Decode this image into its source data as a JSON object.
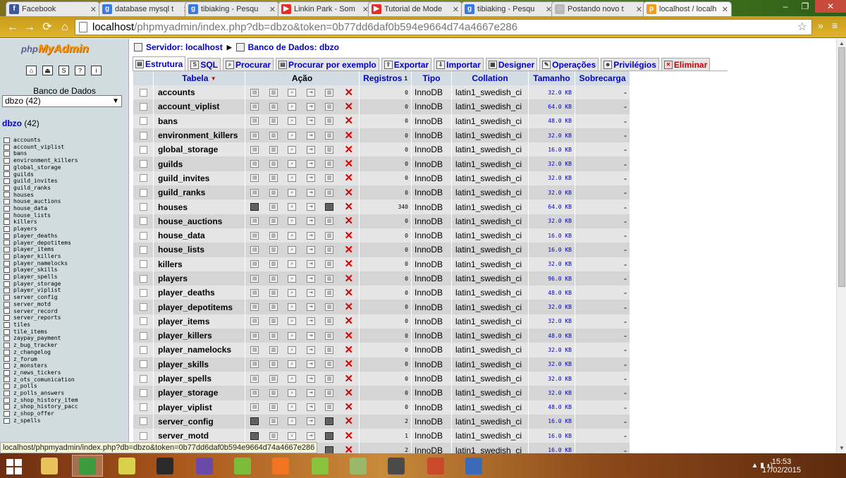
{
  "browser": {
    "tabs": [
      {
        "title": "Facebook",
        "icon": "facebook-icon",
        "color": "#3b5998",
        "glyph": "f"
      },
      {
        "title": "database mysql t",
        "icon": "google-icon",
        "color": "#3b78e7",
        "glyph": "g"
      },
      {
        "title": "tibiaking - Pesqu",
        "icon": "google-icon",
        "color": "#3b78e7",
        "glyph": "g"
      },
      {
        "title": "Linkin Park - Som",
        "icon": "youtube-icon",
        "color": "#e52d27",
        "glyph": "▶"
      },
      {
        "title": "Tutorial de Mode",
        "icon": "youtube-icon",
        "color": "#e52d27",
        "glyph": "▶"
      },
      {
        "title": "tibiaking - Pesqu",
        "icon": "google-icon",
        "color": "#3b78e7",
        "glyph": "g"
      },
      {
        "title": "Postando novo t",
        "icon": "loading-icon",
        "color": "#b9b9b9",
        "glyph": "◌"
      },
      {
        "title": "localhost / localh",
        "icon": "phpmyadmin-icon",
        "color": "#f59c1a",
        "glyph": "p"
      }
    ],
    "url_host": "localhost",
    "url_path": "/phpmyadmin/index.php?db=dbzo&token=0b77dd6daf0b594e9664d74a4667e286"
  },
  "sidebar": {
    "logo_php": "php",
    "logo_rest": "MyAdmin",
    "icons": [
      "home-icon",
      "exit-icon",
      "sql-icon",
      "docs-icon",
      "help-icon"
    ],
    "db_label": "Banco de Dados",
    "db_selected": "dbzo (42)",
    "db_name": "dbzo",
    "db_count": "(42)",
    "tables": [
      "accounts",
      "account_viplist",
      "bans",
      "environment_killers",
      "global_storage",
      "guilds",
      "guild_invites",
      "guild_ranks",
      "houses",
      "house_auctions",
      "house_data",
      "house_lists",
      "killers",
      "players",
      "player_deaths",
      "player_depotitems",
      "player_items",
      "player_killers",
      "player_namelocks",
      "player_skills",
      "player_spells",
      "player_storage",
      "player_viplist",
      "server_config",
      "server_motd",
      "server_record",
      "server_reports",
      "tiles",
      "tile_items",
      "zaypay_payment",
      "z_bug_tracker",
      "z_changelog",
      "z_forum",
      "z_monsters",
      "z_news_tickers",
      "z_ots_comunication",
      "z_polls",
      "z_polls_answers",
      "z_shop_history_item",
      "z_shop_history_pacc",
      "z_shop_offer",
      "z_spells"
    ]
  },
  "main": {
    "crumb_server_label": "Servidor: localhost",
    "crumb_db_label": "Banco de Dados: dbzo",
    "tabs": [
      {
        "label": "Estrutura",
        "icon": "structure-icon",
        "glyph": "▤",
        "active": true
      },
      {
        "label": "SQL",
        "icon": "sql-icon",
        "glyph": "S"
      },
      {
        "label": "Procurar",
        "icon": "search-icon",
        "glyph": "⌕"
      },
      {
        "label": "Procurar por exemplo",
        "icon": "query-icon",
        "glyph": "▤"
      },
      {
        "label": "Exportar",
        "icon": "export-icon",
        "glyph": "⇪"
      },
      {
        "label": "Importar",
        "icon": "import-icon",
        "glyph": "⇩"
      },
      {
        "label": "Designer",
        "icon": "designer-icon",
        "glyph": "▦"
      },
      {
        "label": "Operações",
        "icon": "wrench-icon",
        "glyph": "✎"
      },
      {
        "label": "Privilégios",
        "icon": "privileges-icon",
        "glyph": "☻"
      },
      {
        "label": "Eliminar",
        "icon": "drop-icon",
        "glyph": "✕",
        "danger": true
      }
    ],
    "columns": {
      "tabela": "Tabela",
      "sort_arrow": "▼",
      "acao": "Ação",
      "registros": "Registros",
      "registros_sup": "1",
      "tipo": "Tipo",
      "collation": "Collation",
      "tamanho": "Tamanho",
      "sobrecarga": "Sobrecarga"
    },
    "rows": [
      {
        "name": "accounts",
        "records": "0",
        "type": "InnoDB",
        "collation": "latin1_swedish_ci",
        "size": "32.0 KB",
        "overhead": "-"
      },
      {
        "name": "account_viplist",
        "records": "0",
        "type": "InnoDB",
        "collation": "latin1_swedish_ci",
        "size": "64.0 KB",
        "overhead": "-"
      },
      {
        "name": "bans",
        "records": "0",
        "type": "InnoDB",
        "collation": "latin1_swedish_ci",
        "size": "48.0 KB",
        "overhead": "-"
      },
      {
        "name": "environment_killers",
        "records": "0",
        "type": "InnoDB",
        "collation": "latin1_swedish_ci",
        "size": "32.0 KB",
        "overhead": "-"
      },
      {
        "name": "global_storage",
        "records": "0",
        "type": "InnoDB",
        "collation": "latin1_swedish_ci",
        "size": "16.0 KB",
        "overhead": "-"
      },
      {
        "name": "guilds",
        "records": "0",
        "type": "InnoDB",
        "collation": "latin1_swedish_ci",
        "size": "32.0 KB",
        "overhead": "-"
      },
      {
        "name": "guild_invites",
        "records": "0",
        "type": "InnoDB",
        "collation": "latin1_swedish_ci",
        "size": "32.0 KB",
        "overhead": "-"
      },
      {
        "name": "guild_ranks",
        "records": "0",
        "type": "InnoDB",
        "collation": "latin1_swedish_ci",
        "size": "32.0 KB",
        "overhead": "-"
      },
      {
        "name": "houses",
        "records": "340",
        "type": "InnoDB",
        "collation": "latin1_swedish_ci",
        "size": "64.0 KB",
        "overhead": "-",
        "filled": true
      },
      {
        "name": "house_auctions",
        "records": "0",
        "type": "InnoDB",
        "collation": "latin1_swedish_ci",
        "size": "32.0 KB",
        "overhead": "-"
      },
      {
        "name": "house_data",
        "records": "0",
        "type": "InnoDB",
        "collation": "latin1_swedish_ci",
        "size": "16.0 KB",
        "overhead": "-"
      },
      {
        "name": "house_lists",
        "records": "0",
        "type": "InnoDB",
        "collation": "latin1_swedish_ci",
        "size": "16.0 KB",
        "overhead": "-"
      },
      {
        "name": "killers",
        "records": "0",
        "type": "InnoDB",
        "collation": "latin1_swedish_ci",
        "size": "32.0 KB",
        "overhead": "-"
      },
      {
        "name": "players",
        "records": "0",
        "type": "InnoDB",
        "collation": "latin1_swedish_ci",
        "size": "96.0 KB",
        "overhead": "-"
      },
      {
        "name": "player_deaths",
        "records": "0",
        "type": "InnoDB",
        "collation": "latin1_swedish_ci",
        "size": "48.0 KB",
        "overhead": "-"
      },
      {
        "name": "player_depotitems",
        "records": "0",
        "type": "InnoDB",
        "collation": "latin1_swedish_ci",
        "size": "32.0 KB",
        "overhead": "-"
      },
      {
        "name": "player_items",
        "records": "0",
        "type": "InnoDB",
        "collation": "latin1_swedish_ci",
        "size": "32.0 KB",
        "overhead": "-"
      },
      {
        "name": "player_killers",
        "records": "0",
        "type": "InnoDB",
        "collation": "latin1_swedish_ci",
        "size": "48.0 KB",
        "overhead": "-"
      },
      {
        "name": "player_namelocks",
        "records": "0",
        "type": "InnoDB",
        "collation": "latin1_swedish_ci",
        "size": "32.0 KB",
        "overhead": "-"
      },
      {
        "name": "player_skills",
        "records": "0",
        "type": "InnoDB",
        "collation": "latin1_swedish_ci",
        "size": "32.0 KB",
        "overhead": "-"
      },
      {
        "name": "player_spells",
        "records": "0",
        "type": "InnoDB",
        "collation": "latin1_swedish_ci",
        "size": "32.0 KB",
        "overhead": "-"
      },
      {
        "name": "player_storage",
        "records": "0",
        "type": "InnoDB",
        "collation": "latin1_swedish_ci",
        "size": "32.0 KB",
        "overhead": "-"
      },
      {
        "name": "player_viplist",
        "records": "0",
        "type": "InnoDB",
        "collation": "latin1_swedish_ci",
        "size": "48.0 KB",
        "overhead": "-"
      },
      {
        "name": "server_config",
        "records": "2",
        "type": "InnoDB",
        "collation": "latin1_swedish_ci",
        "size": "16.0 KB",
        "overhead": "-",
        "filled": true
      },
      {
        "name": "server_motd",
        "records": "1",
        "type": "InnoDB",
        "collation": "latin1_swedish_ci",
        "size": "16.0 KB",
        "overhead": "-",
        "filled": true
      },
      {
        "name": "server_record",
        "records": "2",
        "type": "InnoDB",
        "collation": "latin1_swedish_ci",
        "size": "16.0 KB",
        "overhead": "-",
        "filled": true
      }
    ]
  },
  "status_bar": "localhost/phpmyadmin/index.php?db=dbzo&token=0b77dd6daf0b594e9664d74a4667e286",
  "taskbar": {
    "apps": [
      {
        "icon": "file-explorer-icon",
        "color": "#e8c25a",
        "active": false
      },
      {
        "icon": "chrome-icon",
        "color": "#3d9a3d",
        "active": true
      },
      {
        "icon": "notepad-icon",
        "color": "#d8d24a",
        "active": false
      },
      {
        "icon": "avatar-app-icon",
        "color": "#2a2a2a",
        "active": false
      },
      {
        "icon": "game-icon",
        "color": "#6a4aa8",
        "active": false
      },
      {
        "icon": "chart-app-icon",
        "color": "#7dbb3a",
        "active": false
      },
      {
        "icon": "xampp-icon",
        "color": "#f27420",
        "active": false
      },
      {
        "icon": "pycharm-icon",
        "color": "#8ac43f",
        "active": false
      },
      {
        "icon": "map-app-icon",
        "color": "#9ab86a",
        "active": false
      },
      {
        "icon": "media-icon",
        "color": "#4a4a4a",
        "active": false
      },
      {
        "icon": "recycle-icon",
        "color": "#c94a2a",
        "active": false
      },
      {
        "icon": "vb-icon",
        "color": "#3a6ab8",
        "active": false
      }
    ],
    "time": "15:53",
    "date": "17/02/2015"
  }
}
